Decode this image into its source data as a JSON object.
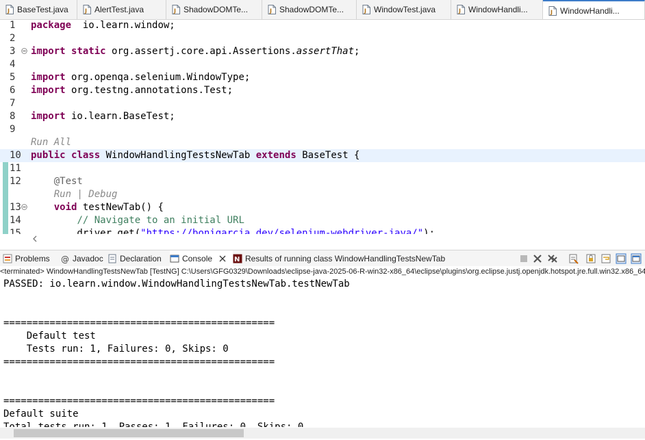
{
  "editor_tabs": [
    {
      "label": "BaseTest.java",
      "active": false
    },
    {
      "label": "AlertTest.java",
      "active": false
    },
    {
      "label": "ShadowDOMTe...",
      "active": false
    },
    {
      "label": "ShadowDOMTe...",
      "active": false
    },
    {
      "label": "WindowTest.java",
      "active": false
    },
    {
      "label": "WindowHandli...",
      "active": false
    },
    {
      "label": "WindowHandli...",
      "active": true
    }
  ],
  "editor": {
    "lines": [
      {
        "num": "1",
        "parts": [
          [
            "kw",
            "package"
          ],
          [
            "",
            "  io.learn.window;"
          ]
        ]
      },
      {
        "num": "2",
        "parts": []
      },
      {
        "num": "3",
        "fold": true,
        "parts": [
          [
            "kw",
            "import"
          ],
          [
            "",
            " "
          ],
          [
            "kw",
            "static"
          ],
          [
            "",
            " org.assertj.core.api.Assertions."
          ],
          [
            "it",
            "assertThat"
          ],
          [
            "",
            ";"
          ]
        ]
      },
      {
        "num": "4",
        "parts": []
      },
      {
        "num": "5",
        "parts": [
          [
            "kw",
            "import"
          ],
          [
            "",
            " org.openqa.selenium.WindowType;"
          ]
        ]
      },
      {
        "num": "6",
        "parts": [
          [
            "kw",
            "import"
          ],
          [
            "",
            " org.testng.annotations.Test;"
          ]
        ]
      },
      {
        "num": "7",
        "parts": []
      },
      {
        "num": "8",
        "parts": [
          [
            "kw",
            "import"
          ],
          [
            "",
            " io.learn.BaseTest;"
          ]
        ]
      },
      {
        "num": "9",
        "parts": []
      },
      {
        "num": "",
        "parts": [
          [
            "lens",
            "Run All"
          ]
        ]
      },
      {
        "num": "10",
        "highlight": true,
        "parts": [
          [
            "kw",
            "public"
          ],
          [
            "",
            " "
          ],
          [
            "kw",
            "class"
          ],
          [
            "",
            " WindowHandlingTestsNewTab "
          ],
          [
            "kw",
            "extends"
          ],
          [
            "",
            " BaseTest {"
          ]
        ]
      },
      {
        "num": "11",
        "parts": []
      },
      {
        "num": "12",
        "parts": [
          [
            "",
            "    "
          ],
          [
            "ann",
            "@Test"
          ]
        ]
      },
      {
        "num": "",
        "parts": [
          [
            "",
            "    "
          ],
          [
            "lens",
            "Run | Debug"
          ]
        ]
      },
      {
        "num": "13",
        "fold": true,
        "parts": [
          [
            "",
            "    "
          ],
          [
            "kw",
            "void"
          ],
          [
            "",
            " testNewTab() {"
          ]
        ]
      },
      {
        "num": "14",
        "parts": [
          [
            "",
            "        "
          ],
          [
            "cm",
            "// Navigate to an initial URL"
          ]
        ]
      },
      {
        "num": "15",
        "parts": [
          [
            "",
            "        driver.get("
          ],
          [
            "st",
            "\"https://bonigarcia.dev/selenium-webdriver-java/\""
          ],
          [
            "",
            ");"
          ]
        ]
      }
    ]
  },
  "views": {
    "tabs": [
      {
        "label": "Problems",
        "icon": "problems-icon"
      },
      {
        "label": "Javadoc",
        "icon": "javadoc-icon"
      },
      {
        "label": "Declaration",
        "icon": "declaration-icon"
      },
      {
        "label": "Console",
        "icon": "console-icon",
        "active": true
      },
      {
        "label": "Results of running class WindowHandlingTestsNewTab",
        "icon": "testng-results-icon"
      }
    ]
  },
  "console": {
    "status": "<terminated> WindowHandlingTestsNewTab [TestNG] C:\\Users\\GFG0329\\Downloads\\eclipse-java-2025-06-R-win32-x86_64\\eclipse\\plugins\\org.eclipse.justj.openjdk.hotspot.jre.full.win32.x86_64",
    "lines": [
      "PASSED: io.learn.window.WindowHandlingTestsNewTab.testNewTab",
      "",
      "",
      "===============================================",
      "    Default test",
      "    Tests run: 1, Failures: 0, Skips: 0",
      "===============================================",
      "",
      "",
      "===============================================",
      "Default suite",
      "Total tests run: 1, Passes: 1, Failures: 0, Skips: 0"
    ]
  }
}
